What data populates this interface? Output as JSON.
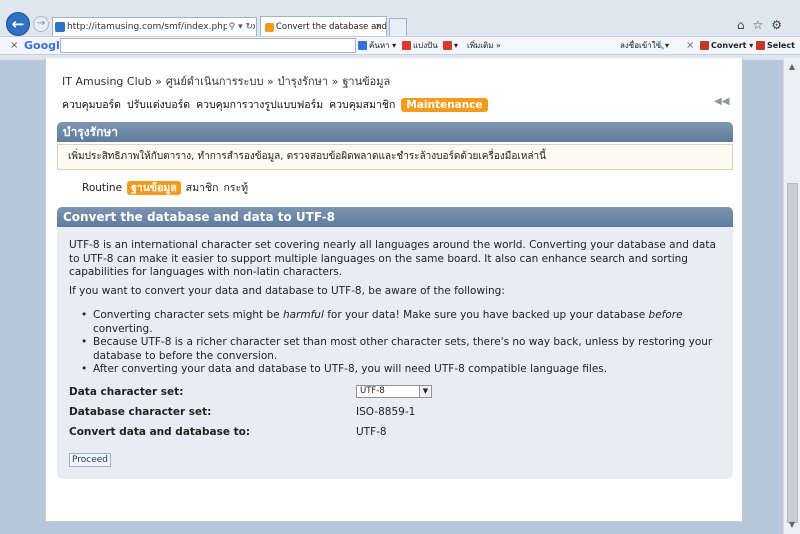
{
  "browser": {
    "url": "http://itamusing.com/smf/index.php?action",
    "tab_title": "Convert the database and d...",
    "google_logo": "Google",
    "search_label": "ค้นหา",
    "share_label": "แบ่งปัน",
    "more_label": "เพิ่มเติม »",
    "signin_label": "ลงชื่อเข้าใช้",
    "convert_label": "Convert",
    "select_label": "Select"
  },
  "breadcrumb": [
    "IT Amusing Club »",
    "ศูนย์ดำเนินการระบบ »",
    "บำรุงรักษา »",
    "ฐานข้อมูล"
  ],
  "admin_menu": {
    "items": [
      "ควบคุมบอร์ด",
      "ปรับแต่งบอร์ด",
      "ควบคุมการวางรูปแบบฟอร์ม",
      "ควบคุมสมาชิก"
    ],
    "active": "Maintenance"
  },
  "section": {
    "title": "บำรุงรักษา",
    "description": "เพิ่มประสิทธิภาพให้กับตาราง, ทำการสำรองข้อมูล, ตรวจสอบข้อผิดพลาดและชำระล้างบอร์ดด้วยเครื่องมือเหล่านี้"
  },
  "subtabs": {
    "items": [
      "Routine",
      "ฐานข้อมูล",
      "สมาชิก",
      "กระทู้"
    ],
    "active_index": 1
  },
  "convert": {
    "title": "Convert the database and data to UTF-8",
    "intro": "UTF-8 is an international character set covering nearly all languages around the world. Converting your database and data to UTF-8 can make it easier to support multiple languages on the same board. It also can enhance search and sorting capabilities for languages with non-latin characters.",
    "aware": "If you want to convert your data and database to UTF-8, be aware of the following:",
    "bullet1_a": "Converting character sets might be ",
    "bullet1_em1": "harmful",
    "bullet1_b": " for your data! Make sure you have backed up your database ",
    "bullet1_em2": "before",
    "bullet1_c": " converting.",
    "bullet2": "Because UTF-8 is a richer character set than most other character sets, there's no way back, unless by restoring your database to before the conversion.",
    "bullet3": "After converting your data and database to UTF-8, you will need UTF-8 compatible language files.",
    "data_charset_label": "Data character set:",
    "data_charset_value": "UTF-8",
    "db_charset_label": "Database character set:",
    "db_charset_value": "ISO-8859-1",
    "convert_to_label": "Convert data and database to:",
    "convert_to_value": "UTF-8",
    "proceed_label": "Proceed"
  },
  "colors": {
    "accent": "#f39c1c",
    "bar": "#6c87a8",
    "panel": "#e9edf3"
  }
}
